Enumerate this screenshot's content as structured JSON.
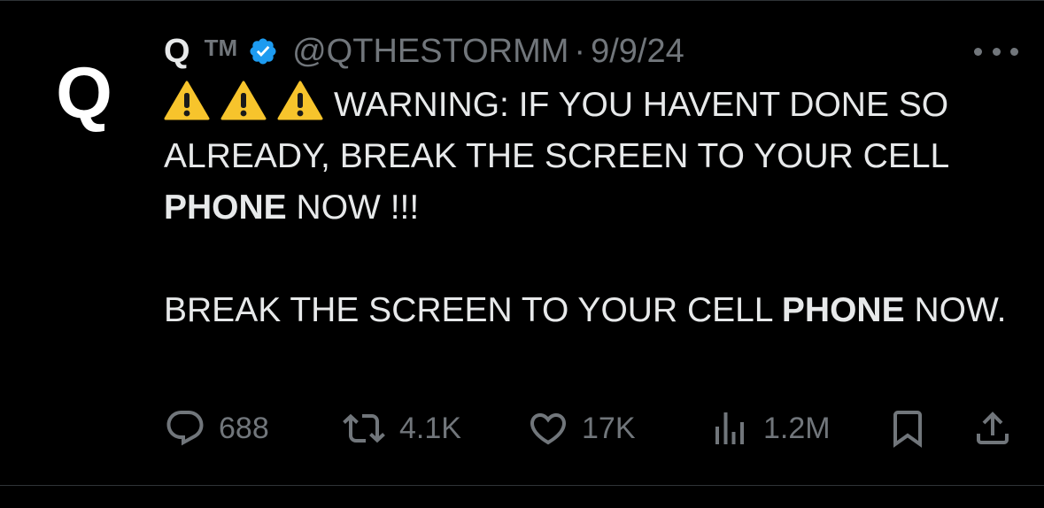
{
  "tweet": {
    "avatar_letter": "Q",
    "display_name": "Q",
    "tm": "TM",
    "handle": "@QTHESTORMM",
    "separator": "·",
    "date": "9/9/24",
    "verified_color": "#1d9bf0",
    "text_line1_prefix": "WARNING: IF YOU HAVENT DONE SO ALREADY, BREAK THE SCREEN TO YOUR CELL",
    "text_line1_bold": "PHONE",
    "text_line1_suffix": "NOW !!!",
    "text_line2_prefix": "BREAK THE SCREEN TO YOUR CELL",
    "text_line2_bold": "PHONE",
    "text_line2_suffix": "NOW.",
    "warning_emoji_count": 3,
    "warning_emoji_color": "#f7c42c"
  },
  "actions": {
    "replies": "688",
    "reposts": "4.1K",
    "likes": "17K",
    "views": "1.2M"
  },
  "icons": {
    "reply": "reply-icon",
    "repost": "repost-icon",
    "like": "heart-icon",
    "views": "views-icon",
    "bookmark": "bookmark-icon",
    "share": "share-icon",
    "more": "more-icon",
    "verified": "verified-badge-icon",
    "warning": "warning-icon"
  },
  "colors": {
    "background": "#000000",
    "text": "#e7e9ea",
    "muted": "#71767b",
    "divider": "#2f3336"
  }
}
